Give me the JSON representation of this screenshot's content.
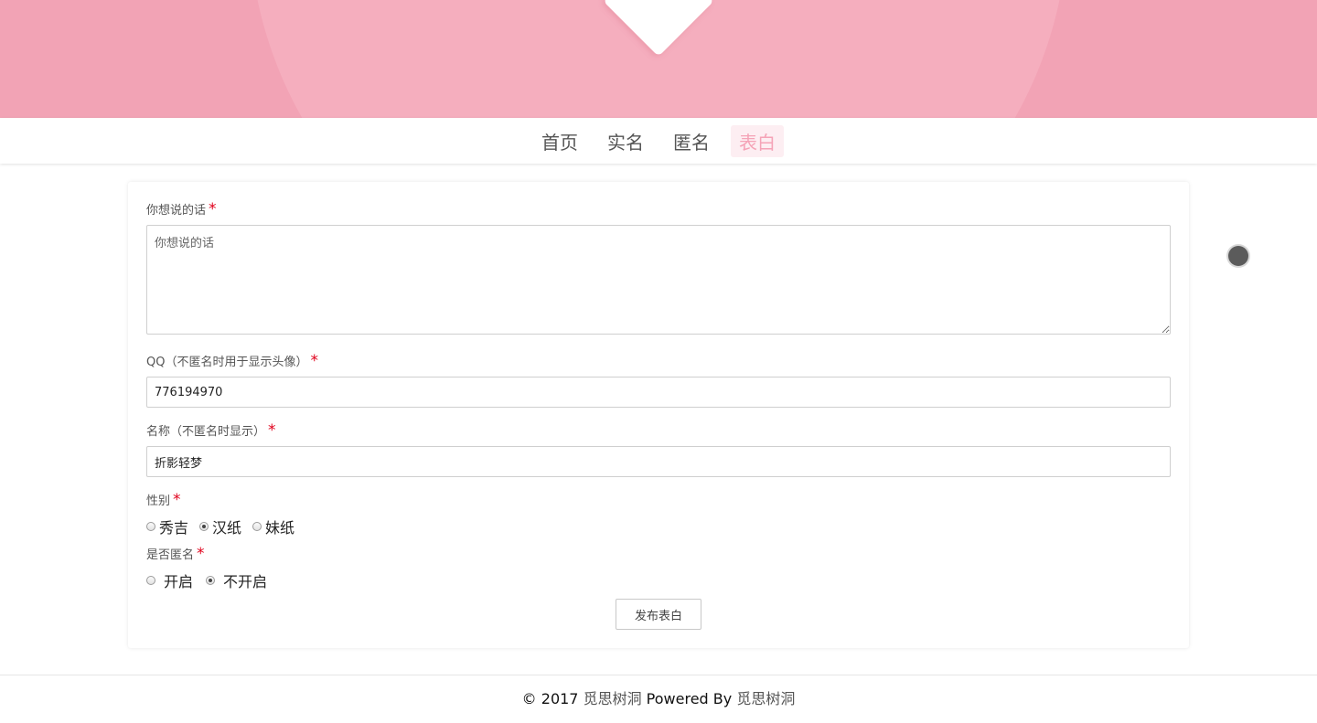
{
  "nav": {
    "items": [
      {
        "label": "首页"
      },
      {
        "label": "实名"
      },
      {
        "label": "匿名"
      },
      {
        "label": "表白"
      }
    ]
  },
  "form": {
    "message": {
      "label": "你想说的话",
      "placeholder": "你想说的话",
      "value": ""
    },
    "qq": {
      "label": "QQ（不匿名时用于显示头像）",
      "value": "776194970"
    },
    "name": {
      "label": "名称（不匿名时显示）",
      "value": "折影轻梦"
    },
    "gender": {
      "label": "性别",
      "options": [
        "秀吉",
        "汉纸",
        "妹纸"
      ],
      "selected": "汉纸"
    },
    "anonymous": {
      "label": "是否匿名",
      "options": [
        "开启",
        "不开启"
      ],
      "selected": "不开启"
    },
    "required_mark": "*",
    "submit_label": "发布表白"
  },
  "footer": {
    "prefix": "© 2017 ",
    "site_link": "觅思树洞",
    "middle": " Powered By ",
    "powered_link": "觅思树洞"
  },
  "colors": {
    "hero": "#f2a3b5",
    "nav_active_text": "#f5a3b7",
    "nav_active_bg": "#fdeef2",
    "required": "#e0001b"
  },
  "icons": {
    "music_player": "music-disc-icon",
    "hero_decoration": "heart-icon"
  }
}
